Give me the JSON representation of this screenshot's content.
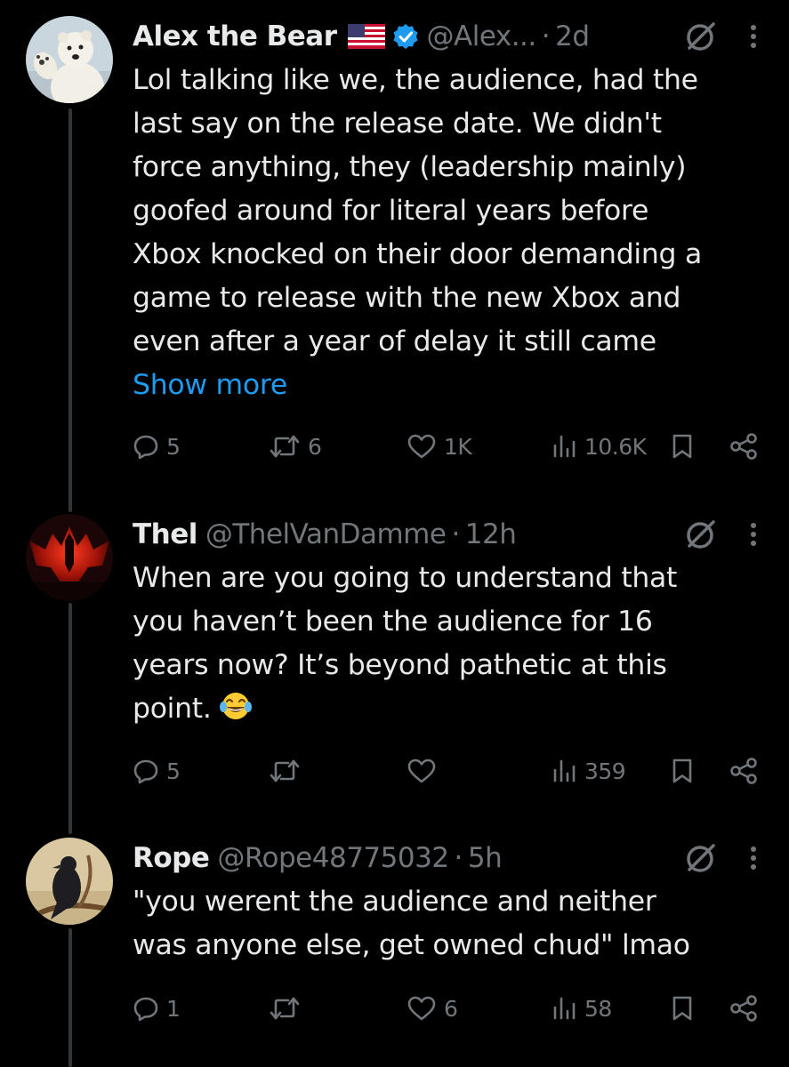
{
  "colors": {
    "background": "#000000",
    "text_primary": "#e7e9ea",
    "text_secondary": "#71767b",
    "link": "#1d9bf0",
    "verified": "#1d9bf0",
    "thread_line": "#333639"
  },
  "tweets": [
    {
      "display_name": "Alex the Bear",
      "flag_icon": "us-flag-icon",
      "verified_icon": "verified-badge-icon",
      "handle": "@Alex...",
      "separator": "·",
      "time": "2d",
      "avatar_icon": "polar-bear-avatar",
      "lines": [
        "Lol talking like we, the audience, had the",
        "last say on the release date. We didn't",
        "force anything, they (leadership mainly)",
        "goofed around for literal years before",
        "Xbox knocked on their door demanding a",
        "game to release with the new Xbox and",
        "even after a year of delay it still came"
      ],
      "show_more": "Show more",
      "replies": "5",
      "reposts": "6",
      "likes": "1K",
      "views": "10.6K"
    },
    {
      "display_name": "Thel",
      "handle": "@ThelVanDamme",
      "separator": "·",
      "time": "12h",
      "avatar_icon": "red-bat-avatar",
      "lines": [
        "When are you going to understand that",
        "you haven’t been the audience for 16",
        "years now? It’s beyond pathetic at this",
        "point."
      ],
      "emoji_icon": "face-with-tears-of-joy-emoji",
      "replies": "5",
      "reposts": "",
      "likes": "",
      "views": "359"
    },
    {
      "display_name": "Rope",
      "handle": "@Rope48775032",
      "separator": "·",
      "time": "5h",
      "avatar_icon": "crow-avatar",
      "lines": [
        "\"you werent the audience and neither",
        "was anyone else, get owned chud\" lmao"
      ],
      "replies": "1",
      "reposts": "",
      "likes": "6",
      "views": "58"
    }
  ]
}
